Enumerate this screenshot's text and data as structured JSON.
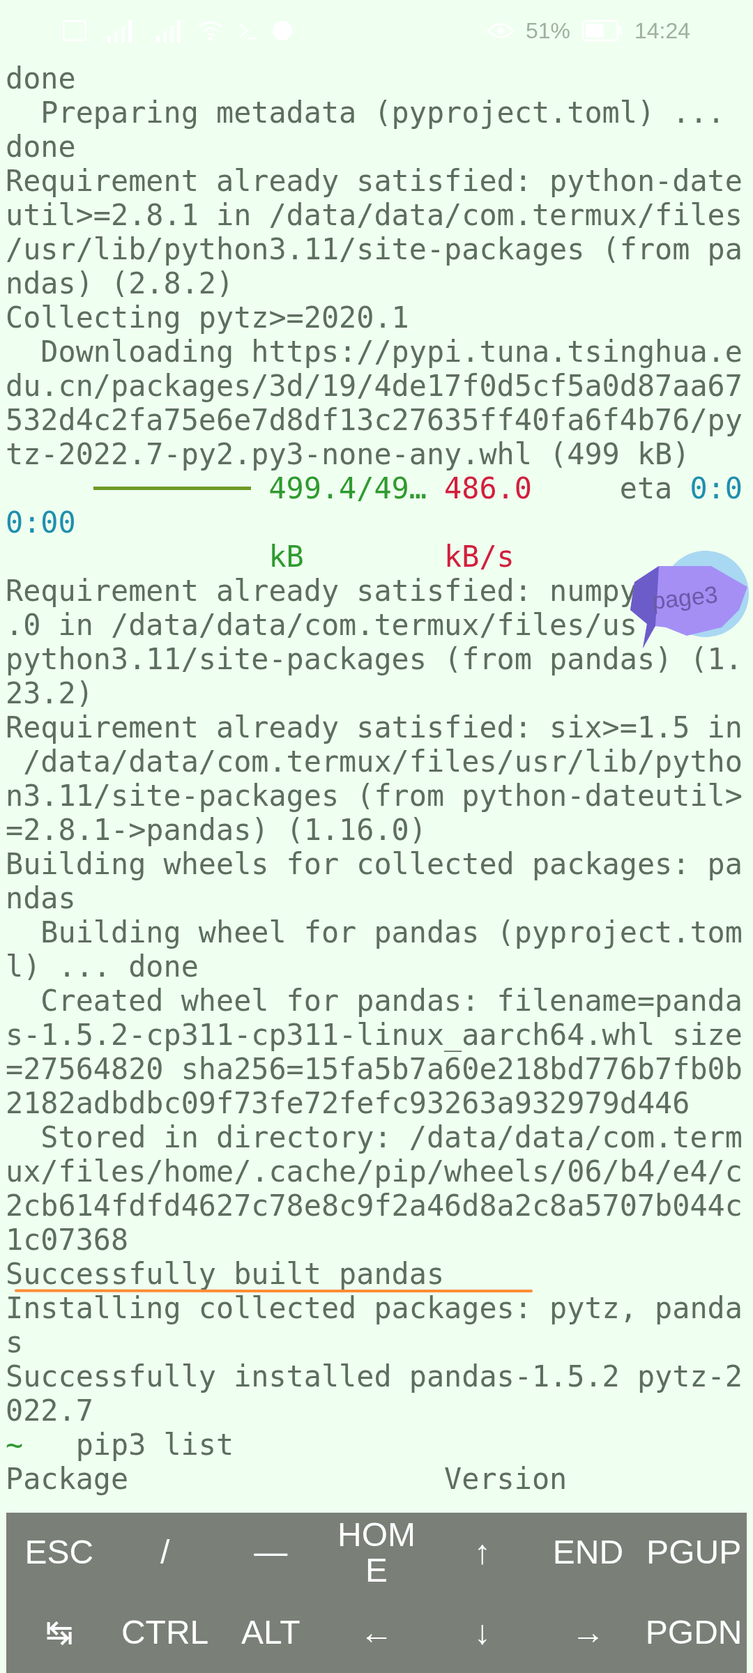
{
  "status_bar": {
    "battery_percent": "51%",
    "time": "14:24"
  },
  "terminal": {
    "lines": [
      {
        "segments": [
          {
            "text": "done",
            "color": "#5e6e5e"
          }
        ]
      },
      {
        "segments": [
          {
            "text": "  Preparing metadata (pyproject.toml) ...",
            "color": "#5e6e5e"
          }
        ]
      },
      {
        "segments": [
          {
            "text": "done",
            "color": "#5e6e5e"
          }
        ]
      },
      {
        "segments": [
          {
            "text": "Requirement already satisfied: python-date",
            "color": "#5e6e5e"
          }
        ]
      },
      {
        "segments": [
          {
            "text": "util>=2.8.1 in /data/data/com.termux/files",
            "color": "#5e6e5e"
          }
        ]
      },
      {
        "segments": [
          {
            "text": "/usr/lib/python3.11/site-packages (from pa",
            "color": "#5e6e5e"
          }
        ]
      },
      {
        "segments": [
          {
            "text": "ndas) (2.8.2)",
            "color": "#5e6e5e"
          }
        ]
      },
      {
        "segments": [
          {
            "text": "Collecting pytz>=2020.1",
            "color": "#5e6e5e"
          }
        ]
      },
      {
        "segments": [
          {
            "text": "  Downloading https://pypi.tuna.tsinghua.e",
            "color": "#5e6e5e"
          }
        ]
      },
      {
        "segments": [
          {
            "text": "du.cn/packages/3d/19/4de17f0d5cf5a0d87aa67",
            "color": "#5e6e5e"
          }
        ]
      },
      {
        "segments": [
          {
            "text": "532d4c2fa75e6e7d8df13c27635ff40fa6f4b76/py",
            "color": "#5e6e5e"
          }
        ]
      },
      {
        "segments": [
          {
            "text": "tz-2022.7-py2.py3-none-any.whl (499 kB)",
            "color": "#5e6e5e"
          }
        ]
      },
      {
        "segments": [
          {
            "kind": "bar",
            "color": "#6f9a24"
          },
          {
            "text": "499.4/49…",
            "color": "#2f9a2f"
          },
          {
            "text": "486.0",
            "color": "#d21f3c"
          },
          {
            "text": "eta",
            "color": "#5e6e5e"
          },
          {
            "text": "0:0",
            "color": "#1f8fae"
          }
        ]
      },
      {
        "segments": [
          {
            "text": "0:00",
            "color": "#1f8fae"
          }
        ]
      },
      {
        "segments": [
          {
            "text": "kB",
            "color": "#2f9a2f"
          },
          {
            "text": "kB/s",
            "color": "#d21f3c"
          }
        ]
      },
      {
        "segments": [
          {
            "text": "Requirement already satisfied: numpy",
            "color": "#5e6e5e"
          }
        ]
      },
      {
        "segments": [
          {
            "text": ".0 in /data/data/com.termux/files/us",
            "color": "#5e6e5e"
          }
        ]
      },
      {
        "segments": [
          {
            "text": "python3.11/site-packages (from pandas) (1.",
            "color": "#5e6e5e"
          }
        ]
      },
      {
        "segments": [
          {
            "text": "23.2)",
            "color": "#5e6e5e"
          }
        ]
      },
      {
        "segments": [
          {
            "text": "Requirement already satisfied: six>=1.5 in",
            "color": "#5e6e5e"
          }
        ]
      },
      {
        "segments": [
          {
            "text": " /data/data/com.termux/files/usr/lib/pytho",
            "color": "#5e6e5e"
          }
        ]
      },
      {
        "segments": [
          {
            "text": "n3.11/site-packages (from python-dateutil>",
            "color": "#5e6e5e"
          }
        ]
      },
      {
        "segments": [
          {
            "text": "=2.8.1->pandas) (1.16.0)",
            "color": "#5e6e5e"
          }
        ]
      },
      {
        "segments": [
          {
            "text": "Building wheels for collected packages: pa",
            "color": "#5e6e5e"
          }
        ]
      },
      {
        "segments": [
          {
            "text": "ndas",
            "color": "#5e6e5e"
          }
        ]
      },
      {
        "segments": [
          {
            "text": "  Building wheel for pandas (pyproject.tom",
            "color": "#5e6e5e"
          }
        ]
      },
      {
        "segments": [
          {
            "text": "l) ... done",
            "color": "#5e6e5e"
          }
        ]
      },
      {
        "segments": [
          {
            "text": "  Created wheel for pandas: filename=panda",
            "color": "#5e6e5e"
          }
        ]
      },
      {
        "segments": [
          {
            "text": "s-1.5.2-cp311-cp311-linux_aarch64.whl size",
            "color": "#5e6e5e"
          }
        ]
      },
      {
        "segments": [
          {
            "text": "=27564820 sha256=15fa5b7a60e218bd776b7fb0b",
            "color": "#5e6e5e"
          }
        ]
      },
      {
        "segments": [
          {
            "text": "2182adbdbc09f73fe72fefc93263a932979d446",
            "color": "#5e6e5e"
          }
        ]
      },
      {
        "segments": [
          {
            "text": "  Stored in directory: /data/data/com.term",
            "color": "#5e6e5e"
          }
        ]
      },
      {
        "segments": [
          {
            "text": "ux/files/home/.cache/pip/wheels/06/b4/e4/c",
            "color": "#5e6e5e"
          }
        ]
      },
      {
        "segments": [
          {
            "text": "2cb614fdfd4627c78e8c9f2a46d8a2c8a5707b044c",
            "color": "#5e6e5e"
          }
        ]
      },
      {
        "segments": [
          {
            "text": "1c07368",
            "color": "#5e6e5e"
          }
        ]
      },
      {
        "segments": [
          {
            "text": "Successfully built pandas",
            "color": "#5e6e5e"
          }
        ]
      },
      {
        "segments": [
          {
            "text": "Installing collected packages: pytz, panda",
            "color": "#5e6e5e"
          }
        ]
      },
      {
        "segments": [
          {
            "text": "s",
            "color": "#5e6e5e"
          }
        ]
      },
      {
        "segments": [
          {
            "text": "Successfully installed pandas-1.5.2 pytz-2",
            "color": "#5e6e5e"
          }
        ]
      },
      {
        "segments": [
          {
            "text": "022.7",
            "color": "#5e6e5e"
          }
        ]
      },
      {
        "segments": [
          {
            "text": "~",
            "color": "#2f9a2f"
          },
          {
            "text": "pip3 list",
            "color": "#5e6e5e"
          }
        ]
      },
      {
        "segments": [
          {
            "text": "Package",
            "color": "#5e6e5e"
          },
          {
            "text": "Version",
            "color": "#5e6e5e"
          }
        ]
      }
    ]
  },
  "floating_bubble": {
    "label": "page3"
  },
  "extra_keys": [
    [
      {
        "label": "ESC"
      },
      {
        "label": "/"
      },
      {
        "label": "—"
      },
      {
        "label": "HOME"
      },
      {
        "label": "↑"
      },
      {
        "label": "END"
      },
      {
        "label": "PGUP"
      }
    ],
    [
      {
        "label": "↹"
      },
      {
        "label": "CTRL"
      },
      {
        "label": "ALT"
      },
      {
        "label": "←"
      },
      {
        "label": "↓"
      },
      {
        "label": "→"
      },
      {
        "label": "PGDN"
      }
    ]
  ]
}
